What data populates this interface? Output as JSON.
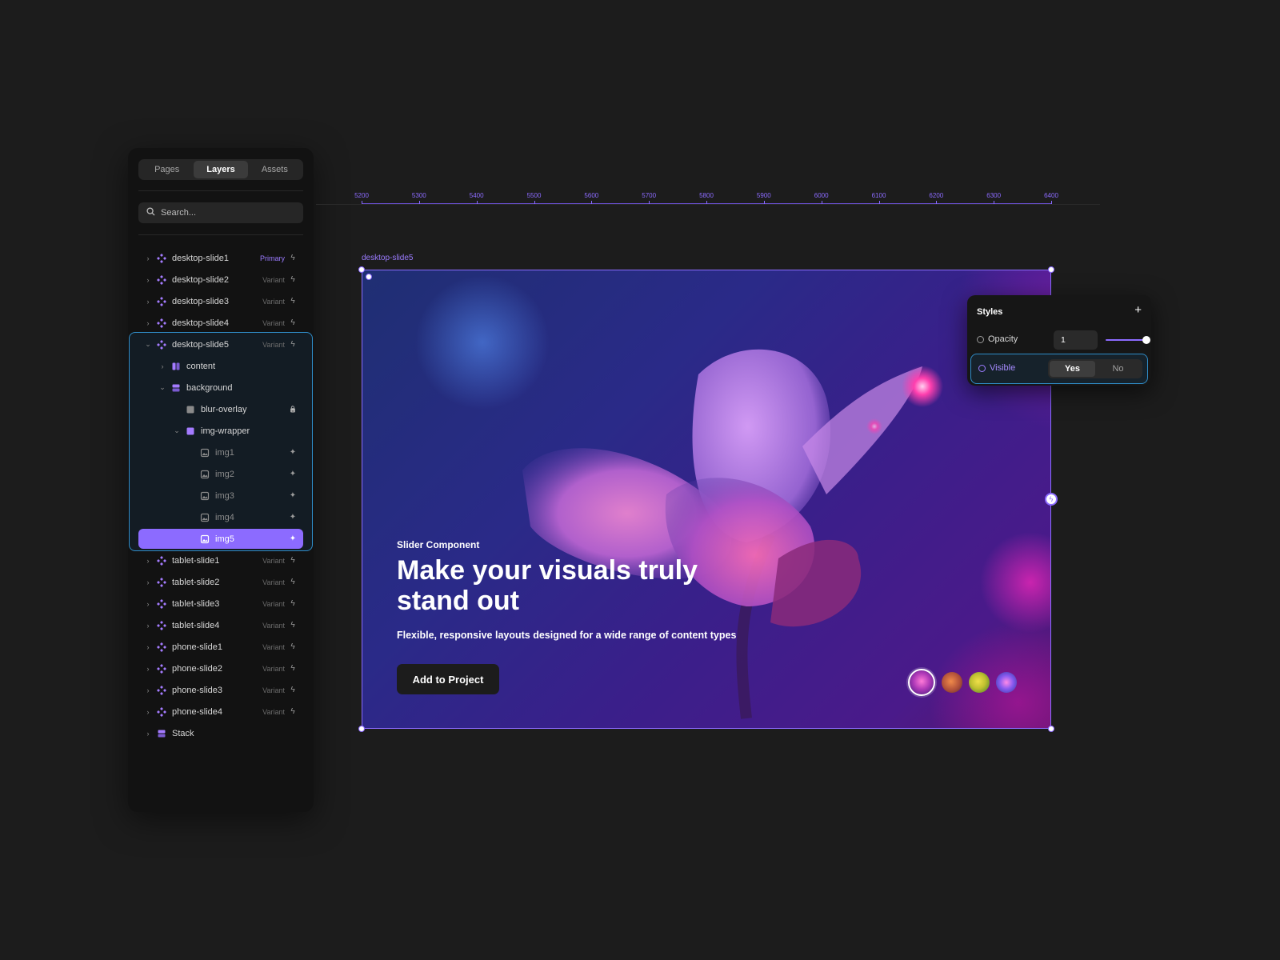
{
  "panel": {
    "tabs": [
      {
        "label": "Pages",
        "active": false
      },
      {
        "label": "Layers",
        "active": true
      },
      {
        "label": "Assets",
        "active": false
      }
    ],
    "search_placeholder": "Search...",
    "layers": [
      {
        "name": "desktop-slide1",
        "tag": "Primary",
        "icon": "component-icon",
        "action": "bolt-icon"
      },
      {
        "name": "desktop-slide2",
        "tag": "Variant",
        "icon": "component-icon",
        "action": "bolt-icon"
      },
      {
        "name": "desktop-slide3",
        "tag": "Variant",
        "icon": "component-icon",
        "action": "bolt-icon"
      },
      {
        "name": "desktop-slide4",
        "tag": "Variant",
        "icon": "component-icon",
        "action": "bolt-icon"
      },
      {
        "name": "desktop-slide5",
        "tag": "Variant",
        "icon": "component-icon",
        "action": "bolt-icon",
        "expanded": true
      },
      {
        "name": "content",
        "tag": "",
        "icon": "columns-icon",
        "action": ""
      },
      {
        "name": "background",
        "tag": "",
        "icon": "stack-icon",
        "action": "",
        "expanded": true
      },
      {
        "name": "blur-overlay",
        "tag": "",
        "icon": "square-icon",
        "action": "lock-icon"
      },
      {
        "name": "img-wrapper",
        "tag": "",
        "icon": "frame-icon",
        "action": "",
        "expanded": true
      },
      {
        "name": "img1",
        "tag": "",
        "icon": "image-icon",
        "action": "sparkle-icon"
      },
      {
        "name": "img2",
        "tag": "",
        "icon": "image-icon",
        "action": "sparkle-icon"
      },
      {
        "name": "img3",
        "tag": "",
        "icon": "image-icon",
        "action": "sparkle-icon"
      },
      {
        "name": "img4",
        "tag": "",
        "icon": "image-icon",
        "action": "sparkle-icon"
      },
      {
        "name": "img5",
        "tag": "",
        "icon": "image-icon",
        "action": "sparkle-icon",
        "selected": true
      },
      {
        "name": "tablet-slide1",
        "tag": "Variant",
        "icon": "component-icon",
        "action": "bolt-icon"
      },
      {
        "name": "tablet-slide2",
        "tag": "Variant",
        "icon": "component-icon",
        "action": "bolt-icon"
      },
      {
        "name": "tablet-slide3",
        "tag": "Variant",
        "icon": "component-icon",
        "action": "bolt-icon"
      },
      {
        "name": "tablet-slide4",
        "tag": "Variant",
        "icon": "component-icon",
        "action": "bolt-icon"
      },
      {
        "name": "phone-slide1",
        "tag": "Variant",
        "icon": "component-icon",
        "action": "bolt-icon"
      },
      {
        "name": "phone-slide2",
        "tag": "Variant",
        "icon": "component-icon",
        "action": "bolt-icon"
      },
      {
        "name": "phone-slide3",
        "tag": "Variant",
        "icon": "component-icon",
        "action": "bolt-icon"
      },
      {
        "name": "phone-slide4",
        "tag": "Variant",
        "icon": "component-icon",
        "action": "bolt-icon"
      },
      {
        "name": "Stack",
        "tag": "",
        "icon": "stack-icon",
        "action": ""
      }
    ]
  },
  "ruler": {
    "ticks": [
      "5200",
      "5300",
      "5400",
      "5500",
      "5600",
      "5700",
      "5800",
      "5900",
      "6000",
      "6100",
      "6200",
      "6300",
      "6400"
    ]
  },
  "frame": {
    "label": "desktop-slide5",
    "eyebrow": "Slider Component",
    "title": "Make your visuals truly stand out",
    "subtitle": "Flexible, responsive layouts designed for a wide range of content types",
    "cta_label": "Add to Project",
    "thumbnails": [
      {
        "name": "thumb-pink-flower",
        "active": true
      },
      {
        "name": "thumb-orange-flower",
        "active": false
      },
      {
        "name": "thumb-yellow-leaf",
        "active": false
      },
      {
        "name": "thumb-blue-flower",
        "active": false
      }
    ]
  },
  "styles_panel": {
    "title": "Styles",
    "add_icon": "plus-icon",
    "opacity_label": "Opacity",
    "opacity_value": "1",
    "opacity_level": 1,
    "visible_label": "Visible",
    "visible_options": [
      "Yes",
      "No"
    ],
    "visible_selected": "Yes"
  },
  "colors": {
    "accent": "#8c6bff",
    "selection_outline": "#2f8cc7",
    "canvas_bg": "#1c1c1c",
    "panel_bg": "#121212"
  }
}
